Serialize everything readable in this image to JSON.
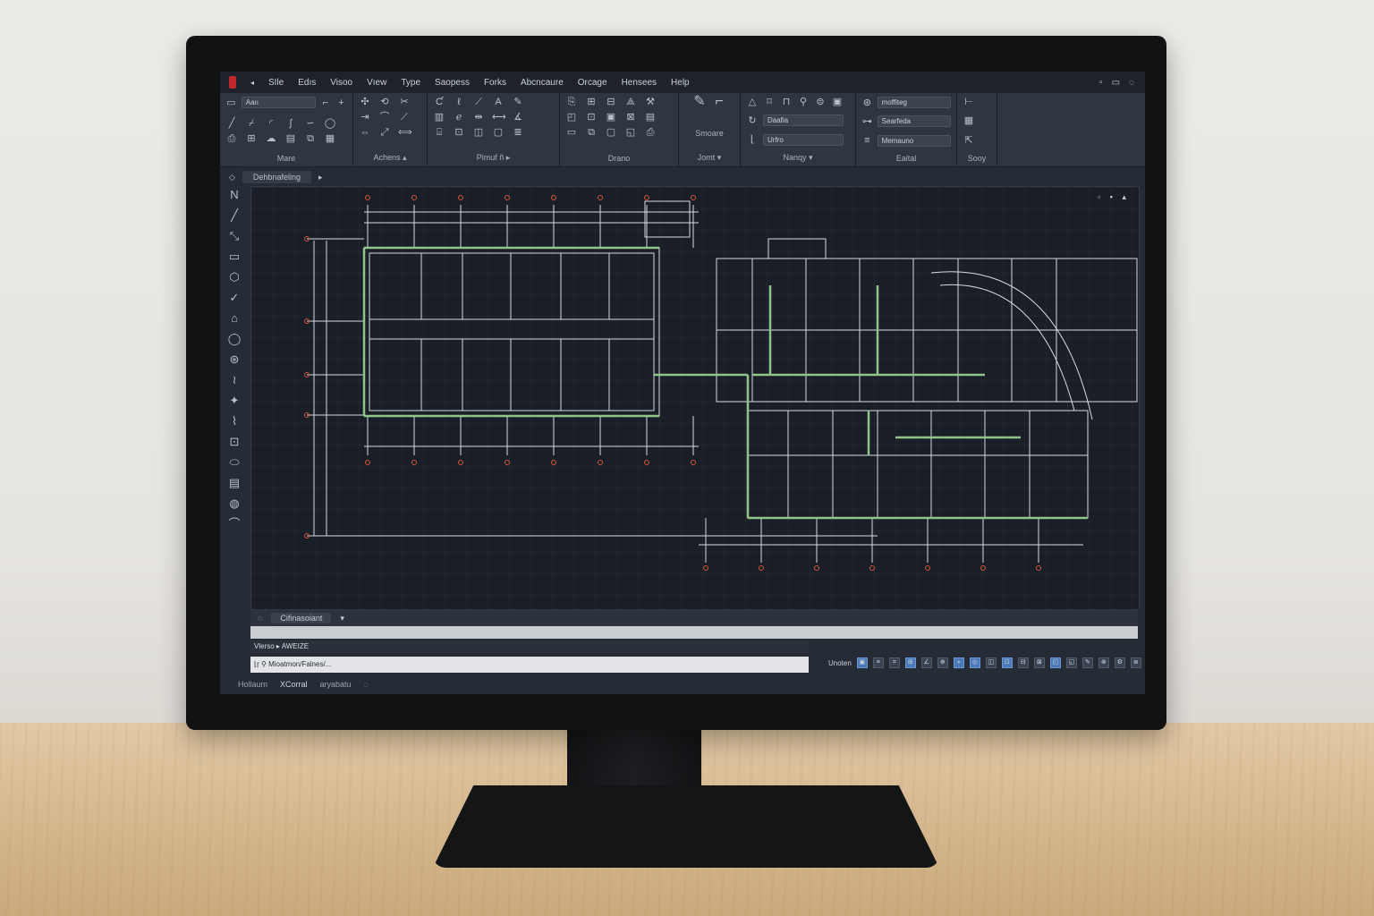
{
  "menu": {
    "items": [
      "ЅIle",
      "Edıs",
      "Visoo",
      "Vıew",
      "Type",
      "Saopess",
      "Forks",
      "Abcncaure",
      "Orcage",
      "Hensees",
      "Help"
    ]
  },
  "ribbon": {
    "panels": [
      {
        "label": "Mare",
        "dropdown": "Aaıı"
      },
      {
        "label": "Achens ▴"
      },
      {
        "label": "Pimuf ñ ▸"
      },
      {
        "label": "Drano"
      },
      {
        "label": "Jomt ▾",
        "tool_label": "Smoare"
      },
      {
        "label": "Nanqy ▾",
        "dropdowns": [
          "Daafia",
          "Urfro"
        ]
      },
      {
        "label": "Eaital",
        "dropdowns": [
          "moffiteg",
          "Searfeda",
          "Memauno"
        ]
      },
      {
        "label": "Sooy"
      }
    ]
  },
  "doc_tab": {
    "label": "Dehbnafeling"
  },
  "command": {
    "tab": "Cifinasoiant",
    "line1": "Vlerso ▸ AWEIZE",
    "line2": "⌊ŗ ⚲ Mioatmon/Falnes/..."
  },
  "status": {
    "label": "Unoten",
    "buttons": [
      "▣",
      "≡",
      "⌗",
      "⊞",
      "∠",
      "⊕",
      "⌖",
      "◎",
      "◫",
      "⊡",
      "⊟",
      "⊠",
      "◰",
      "◱",
      "✎",
      "⊗",
      "⚙",
      "≣"
    ]
  },
  "layout_tabs": [
    "Hollaum",
    "XCorral",
    "aryabatu"
  ],
  "colors": {
    "accent": "#4c79b8",
    "plan_lines": "#d7dbe2",
    "wall_green": "#8fc48a",
    "marker_red": "#d05a3a"
  }
}
